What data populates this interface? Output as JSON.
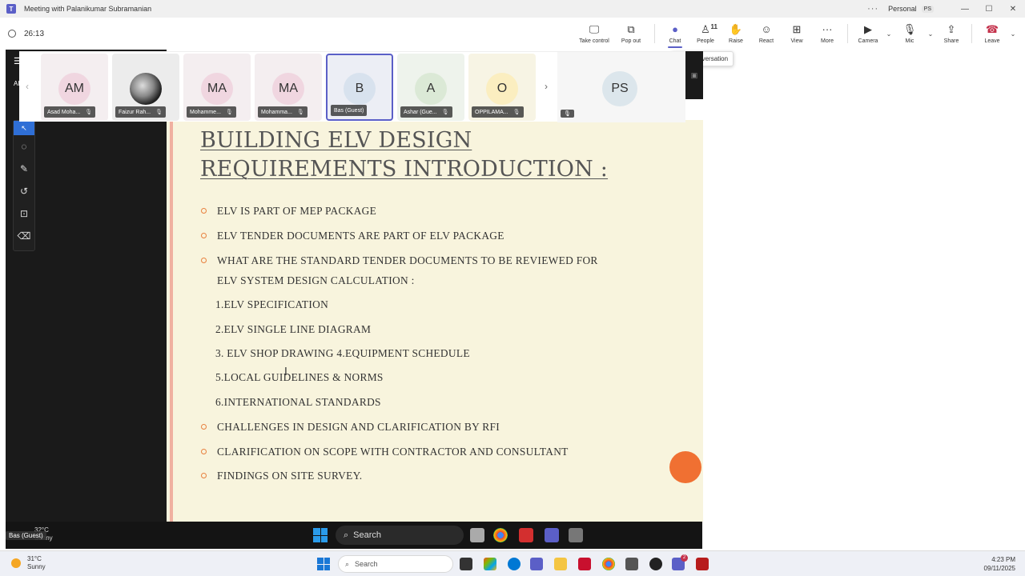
{
  "window": {
    "title": "Meeting with Palanikumar Subramanian",
    "account": "Personal",
    "account_initials": "PS",
    "timer": "26:13"
  },
  "toolbar": {
    "take_control": "Take control",
    "pop_out": "Pop out",
    "chat": "Chat",
    "people": "People",
    "people_count": "11",
    "raise": "Raise",
    "react": "React",
    "view": "View",
    "more": "More",
    "camera": "Camera",
    "mic": "Mic",
    "share": "Share",
    "leave": "Leave",
    "tooltip": "Hide conversation"
  },
  "participants": [
    {
      "initials": "AM",
      "name": "Asad Moha...",
      "color": "#f0d6e0"
    },
    {
      "initials": "",
      "name": "Faizur Rah...",
      "color": "#e8e8e8",
      "photo": true
    },
    {
      "initials": "MA",
      "name": "Mohamme...",
      "color": "#f0d6e0"
    },
    {
      "initials": "MA",
      "name": "Mohamma...",
      "color": "#f0d6e0"
    },
    {
      "initials": "B",
      "name": "Bas (Guest)",
      "color": "#d8e2ee"
    },
    {
      "initials": "A",
      "name": "Ashar (Gue...",
      "color": "#dbe9d6"
    },
    {
      "initials": "O",
      "name": "OPPILAMA...",
      "color": "#fbeec0"
    }
  ],
  "presenter_tile": {
    "initials": "PS"
  },
  "slide": {
    "title_line1": "BUILDING ELV DESIGN",
    "title_line2": "REQUIREMENTS INTRODUCTION :",
    "bullets": [
      "ELV IS PART OF MEP PACKAGE",
      "ELV TENDER DOCUMENTS ARE PART OF ELV PACKAGE",
      "WHAT ARE THE STANDARD TENDER DOCUMENTS TO BE REVIEWED FOR",
      "ELV SYSTEM  DESIGN CALCULATION :",
      "1.ELV SPECIFICATION",
      "2.ELV SINGLE LINE DIAGRAM",
      "3. ELV SHOP DRAWING 4.EQUIPMENT SCHEDULE",
      "5.LOCAL GUIDELINES & NORMS",
      "6.INTERNATIONAL STANDARDS",
      "CHALLENGES IN DESIGN AND CLARIFICATION BY RFI",
      "CLARIFICATION ON SCOPE WITH CONTRACTOR AND CONSULTANT",
      "FINDINGS ON SITE SURVEY."
    ]
  },
  "shared_screen": {
    "guest_label": "Bas (Guest)",
    "weather_temp": "32°C",
    "weather_desc": "Sunny",
    "search": "Search"
  },
  "taskbar": {
    "weather_temp": "31°C",
    "weather_desc": "Sunny",
    "search": "Search",
    "badge": "2",
    "time": "4:23 PM",
    "date": "09/11/2025"
  }
}
